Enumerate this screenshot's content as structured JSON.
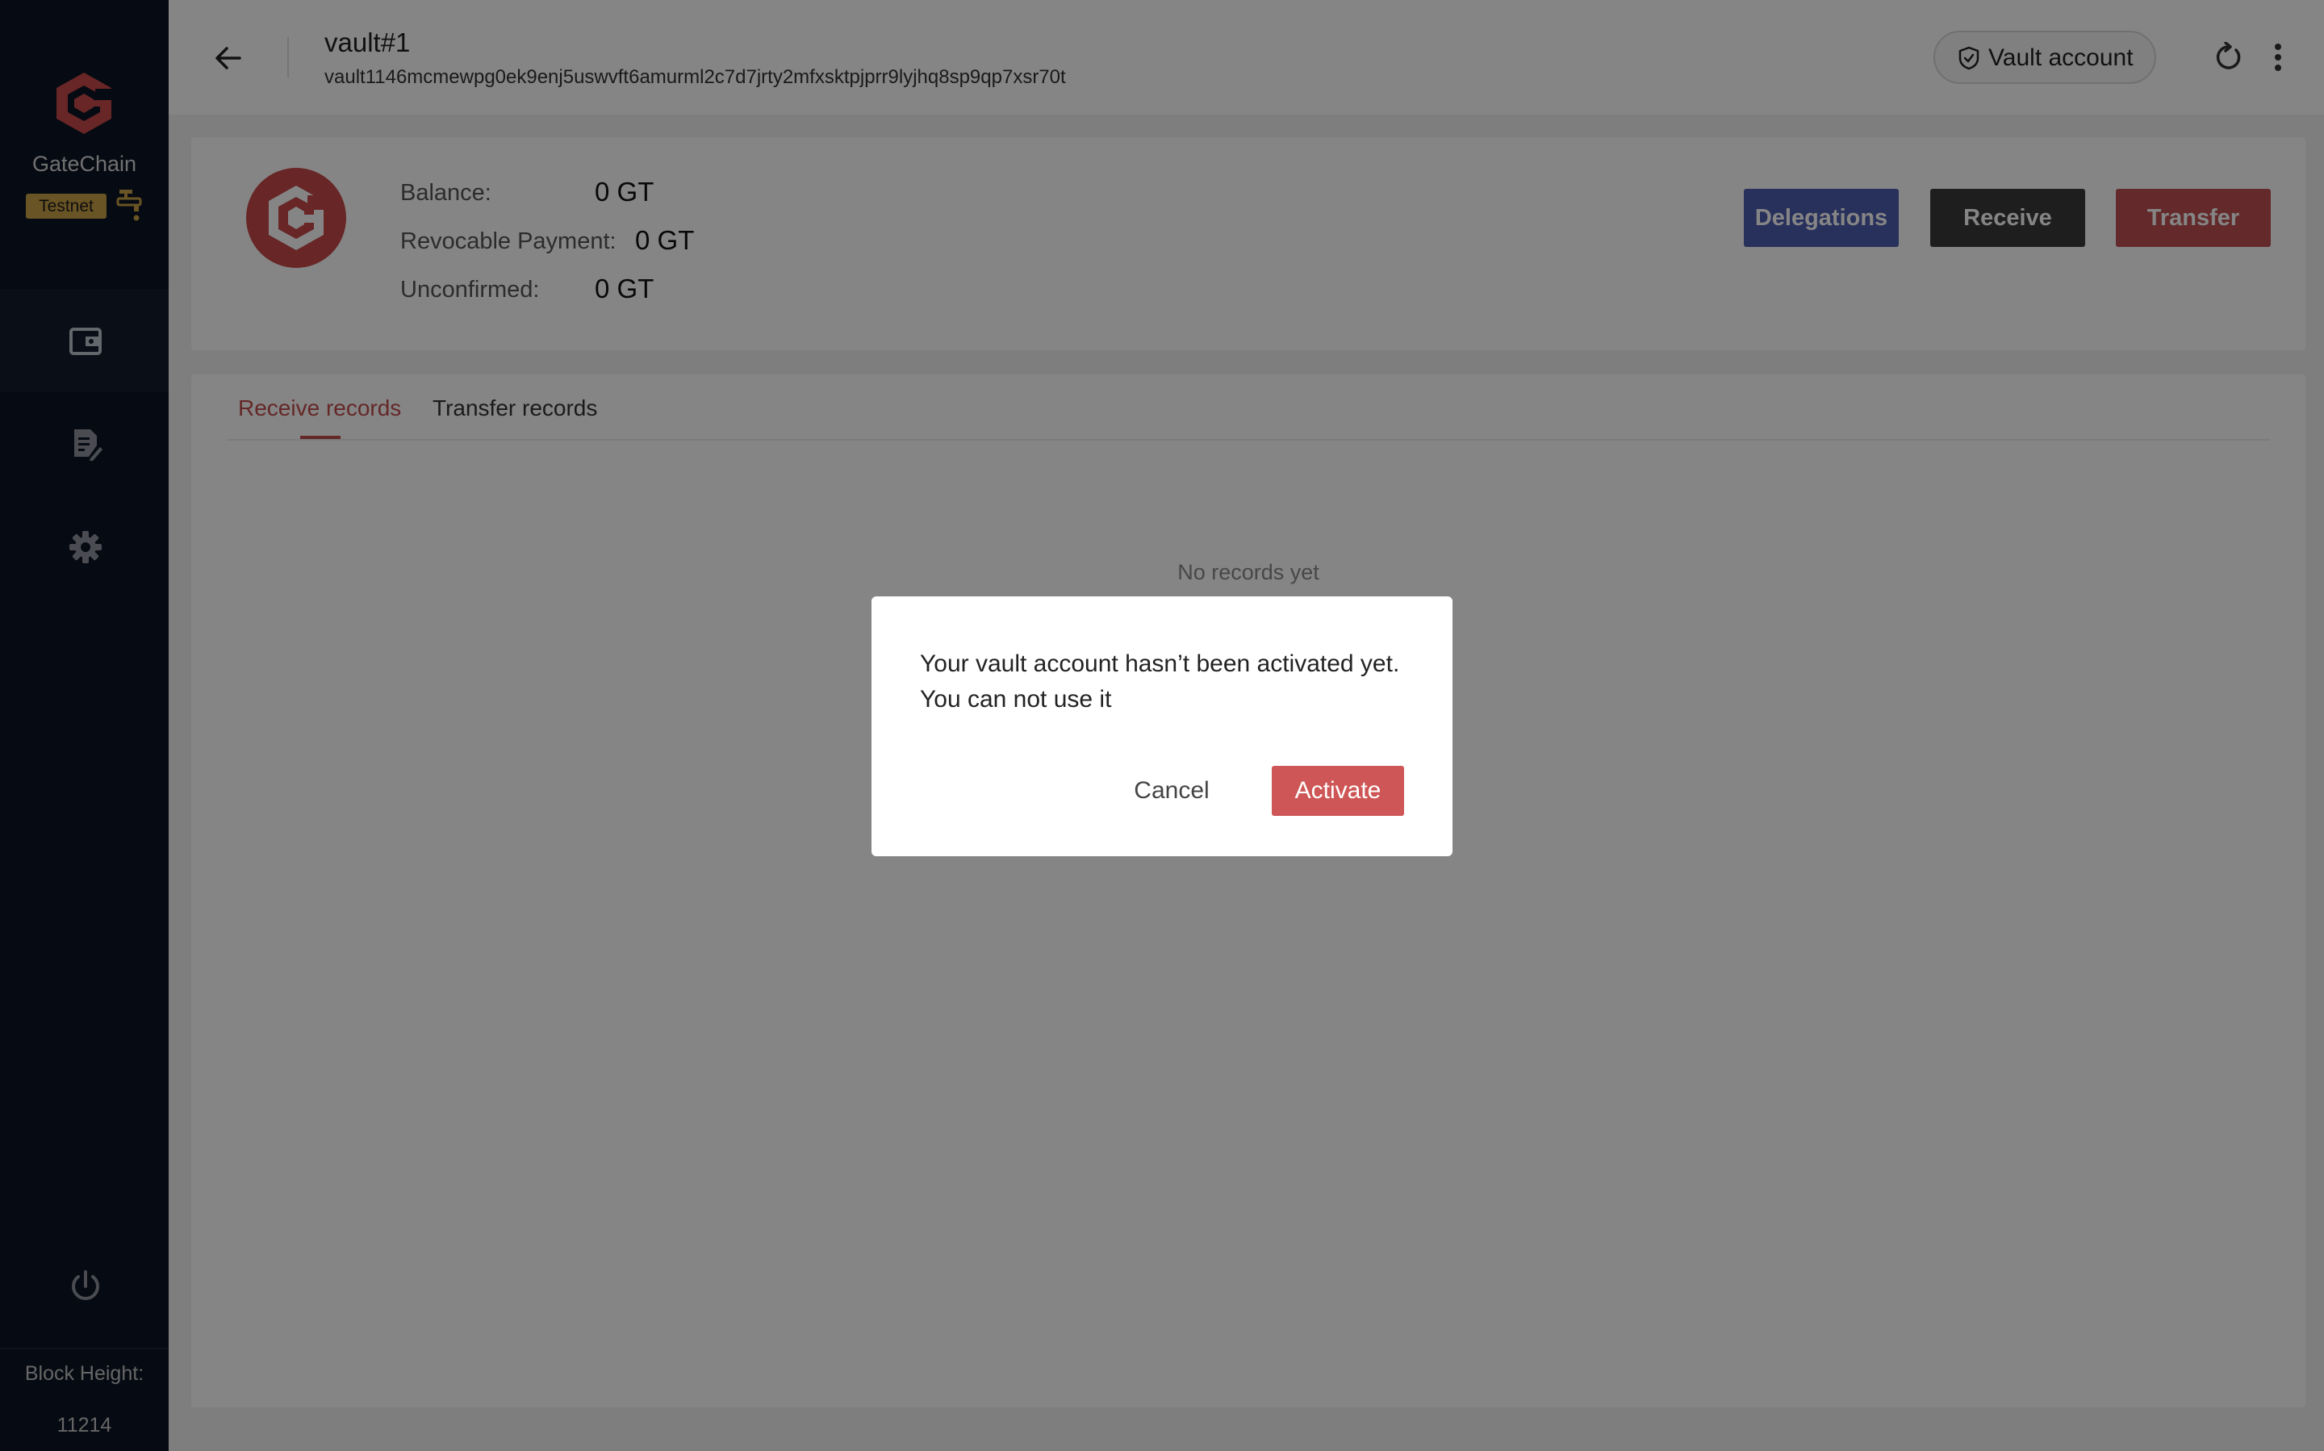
{
  "sidebar": {
    "brand_name": "GateChain",
    "network_badge": "Testnet",
    "block_height_label": "Block Height:",
    "block_height_value": "11214",
    "nav": [
      "wallet-icon",
      "document-edit-icon",
      "settings-icon"
    ]
  },
  "header": {
    "account_name": "vault#1",
    "account_address": "vault1146mcmewpg0ek9enj5uswvft6amurml2c7d7jrty2mfxsktpjprr9lyjhq8sp9qp7xsr70t",
    "account_type": "Vault account"
  },
  "balance": {
    "balance_label": "Balance:",
    "balance_value": "0 GT",
    "revocable_label": "Revocable Payment:",
    "revocable_value": "0 GT",
    "unconfirmed_label": "Unconfirmed:",
    "unconfirmed_value": "0 GT"
  },
  "actions": {
    "delegations": "Delegations",
    "receive": "Receive",
    "transfer": "Transfer"
  },
  "tabs": [
    {
      "label": "Receive records",
      "active": true
    },
    {
      "label": "Transfer records",
      "active": false
    }
  ],
  "empty_text": "No records yet",
  "dialog": {
    "message": "Your vault account hasn’t been activated yet. You can not use it",
    "cancel": "Cancel",
    "activate": "Activate"
  },
  "colors": {
    "sidebar_bg": "#0c1424",
    "accent_red": "#c24c4d",
    "delegations_blue": "#4d5cb0",
    "receive_dark": "#3a3a3a",
    "badge_gold": "#c9a247"
  }
}
